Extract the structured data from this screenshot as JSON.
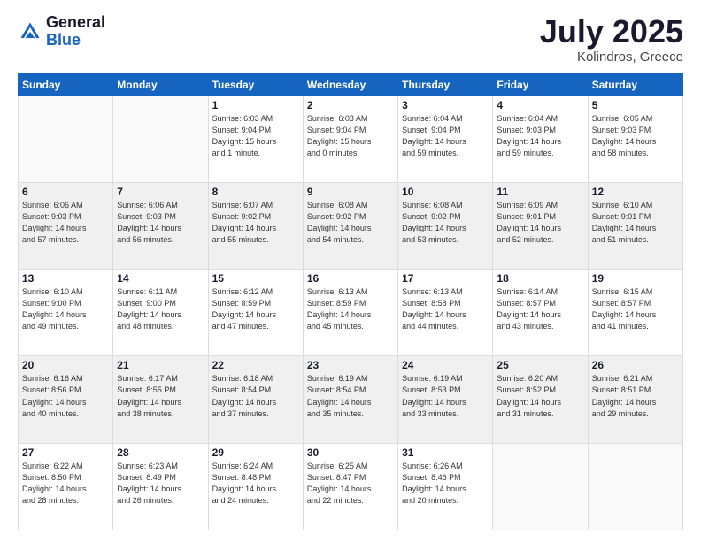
{
  "logo": {
    "general": "General",
    "blue": "Blue"
  },
  "title": {
    "month_year": "July 2025",
    "location": "Kolindros, Greece"
  },
  "headers": [
    "Sunday",
    "Monday",
    "Tuesday",
    "Wednesday",
    "Thursday",
    "Friday",
    "Saturday"
  ],
  "weeks": [
    [
      {
        "day": "",
        "info": ""
      },
      {
        "day": "",
        "info": ""
      },
      {
        "day": "1",
        "info": "Sunrise: 6:03 AM\nSunset: 9:04 PM\nDaylight: 15 hours\nand 1 minute."
      },
      {
        "day": "2",
        "info": "Sunrise: 6:03 AM\nSunset: 9:04 PM\nDaylight: 15 hours\nand 0 minutes."
      },
      {
        "day": "3",
        "info": "Sunrise: 6:04 AM\nSunset: 9:04 PM\nDaylight: 14 hours\nand 59 minutes."
      },
      {
        "day": "4",
        "info": "Sunrise: 6:04 AM\nSunset: 9:03 PM\nDaylight: 14 hours\nand 59 minutes."
      },
      {
        "day": "5",
        "info": "Sunrise: 6:05 AM\nSunset: 9:03 PM\nDaylight: 14 hours\nand 58 minutes."
      }
    ],
    [
      {
        "day": "6",
        "info": "Sunrise: 6:06 AM\nSunset: 9:03 PM\nDaylight: 14 hours\nand 57 minutes."
      },
      {
        "day": "7",
        "info": "Sunrise: 6:06 AM\nSunset: 9:03 PM\nDaylight: 14 hours\nand 56 minutes."
      },
      {
        "day": "8",
        "info": "Sunrise: 6:07 AM\nSunset: 9:02 PM\nDaylight: 14 hours\nand 55 minutes."
      },
      {
        "day": "9",
        "info": "Sunrise: 6:08 AM\nSunset: 9:02 PM\nDaylight: 14 hours\nand 54 minutes."
      },
      {
        "day": "10",
        "info": "Sunrise: 6:08 AM\nSunset: 9:02 PM\nDaylight: 14 hours\nand 53 minutes."
      },
      {
        "day": "11",
        "info": "Sunrise: 6:09 AM\nSunset: 9:01 PM\nDaylight: 14 hours\nand 52 minutes."
      },
      {
        "day": "12",
        "info": "Sunrise: 6:10 AM\nSunset: 9:01 PM\nDaylight: 14 hours\nand 51 minutes."
      }
    ],
    [
      {
        "day": "13",
        "info": "Sunrise: 6:10 AM\nSunset: 9:00 PM\nDaylight: 14 hours\nand 49 minutes."
      },
      {
        "day": "14",
        "info": "Sunrise: 6:11 AM\nSunset: 9:00 PM\nDaylight: 14 hours\nand 48 minutes."
      },
      {
        "day": "15",
        "info": "Sunrise: 6:12 AM\nSunset: 8:59 PM\nDaylight: 14 hours\nand 47 minutes."
      },
      {
        "day": "16",
        "info": "Sunrise: 6:13 AM\nSunset: 8:59 PM\nDaylight: 14 hours\nand 45 minutes."
      },
      {
        "day": "17",
        "info": "Sunrise: 6:13 AM\nSunset: 8:58 PM\nDaylight: 14 hours\nand 44 minutes."
      },
      {
        "day": "18",
        "info": "Sunrise: 6:14 AM\nSunset: 8:57 PM\nDaylight: 14 hours\nand 43 minutes."
      },
      {
        "day": "19",
        "info": "Sunrise: 6:15 AM\nSunset: 8:57 PM\nDaylight: 14 hours\nand 41 minutes."
      }
    ],
    [
      {
        "day": "20",
        "info": "Sunrise: 6:16 AM\nSunset: 8:56 PM\nDaylight: 14 hours\nand 40 minutes."
      },
      {
        "day": "21",
        "info": "Sunrise: 6:17 AM\nSunset: 8:55 PM\nDaylight: 14 hours\nand 38 minutes."
      },
      {
        "day": "22",
        "info": "Sunrise: 6:18 AM\nSunset: 8:54 PM\nDaylight: 14 hours\nand 37 minutes."
      },
      {
        "day": "23",
        "info": "Sunrise: 6:19 AM\nSunset: 8:54 PM\nDaylight: 14 hours\nand 35 minutes."
      },
      {
        "day": "24",
        "info": "Sunrise: 6:19 AM\nSunset: 8:53 PM\nDaylight: 14 hours\nand 33 minutes."
      },
      {
        "day": "25",
        "info": "Sunrise: 6:20 AM\nSunset: 8:52 PM\nDaylight: 14 hours\nand 31 minutes."
      },
      {
        "day": "26",
        "info": "Sunrise: 6:21 AM\nSunset: 8:51 PM\nDaylight: 14 hours\nand 29 minutes."
      }
    ],
    [
      {
        "day": "27",
        "info": "Sunrise: 6:22 AM\nSunset: 8:50 PM\nDaylight: 14 hours\nand 28 minutes."
      },
      {
        "day": "28",
        "info": "Sunrise: 6:23 AM\nSunset: 8:49 PM\nDaylight: 14 hours\nand 26 minutes."
      },
      {
        "day": "29",
        "info": "Sunrise: 6:24 AM\nSunset: 8:48 PM\nDaylight: 14 hours\nand 24 minutes."
      },
      {
        "day": "30",
        "info": "Sunrise: 6:25 AM\nSunset: 8:47 PM\nDaylight: 14 hours\nand 22 minutes."
      },
      {
        "day": "31",
        "info": "Sunrise: 6:26 AM\nSunset: 8:46 PM\nDaylight: 14 hours\nand 20 minutes."
      },
      {
        "day": "",
        "info": ""
      },
      {
        "day": "",
        "info": ""
      }
    ]
  ]
}
